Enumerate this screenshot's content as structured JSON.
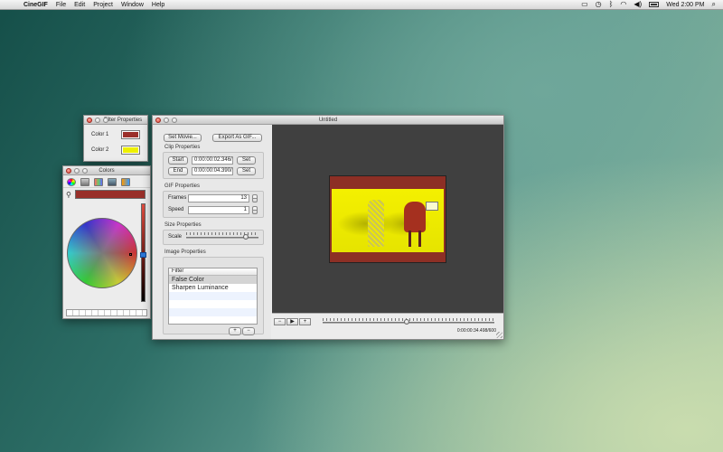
{
  "menubar": {
    "app_name": "CineGIF",
    "menus": [
      "File",
      "Edit",
      "Project",
      "Window",
      "Help"
    ],
    "status_icons": [
      "screen-sharing-icon",
      "time-machine-icon",
      "bluetooth-icon",
      "wifi-icon",
      "volume-icon",
      "battery-icon"
    ],
    "clock": "Wed 2:00 PM"
  },
  "filter_palette": {
    "title": "Filter Properties",
    "color1_label": "Color 1",
    "color1_value": "#9b2f2a",
    "color2_label": "Color 2",
    "color2_value": "#eef000"
  },
  "colors_palette": {
    "title": "Colors",
    "current_color": "#982f29"
  },
  "main_window": {
    "title": "Untitled",
    "set_movie_label": "Set Movie...",
    "export_label": "Export As GIF...",
    "clip": {
      "title": "Clip Properties",
      "start_button": "Start",
      "start_value": "0:00:00:02.346/",
      "end_button": "End",
      "end_value": "0:00:00:04.390/",
      "set_label": "Set"
    },
    "gif": {
      "title": "GIF Properties",
      "frames_label": "Frames",
      "frames_value": "13",
      "speed_label": "Speed",
      "speed_value": "1"
    },
    "size": {
      "title": "Size Properties",
      "scale_label": "Scale",
      "scale_fraction": 0.83
    },
    "image": {
      "title": "Image Properties",
      "column_header": "Filter",
      "filters": [
        "False Color",
        "Sharpen Luminance"
      ],
      "selected_index": 0,
      "add_label": "+",
      "remove_label": "−"
    },
    "transport": {
      "prev_label": "−",
      "play_label": "▶",
      "next_label": "+",
      "position_fraction": 0.49,
      "timecode": "0:00:00:34.498/600"
    },
    "colors": {
      "preview_bg": "#404040",
      "frame_color": "#8d2f25",
      "image_yellow": "#eee800"
    }
  }
}
